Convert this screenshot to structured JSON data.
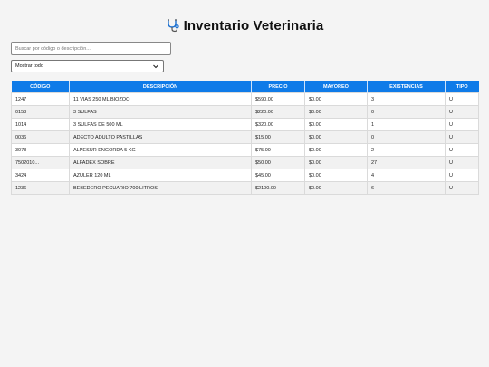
{
  "header": {
    "icon": "stethoscope-icon",
    "title": "Inventario Veterinaria"
  },
  "search": {
    "placeholder": "Buscar por código o descripción...",
    "value": ""
  },
  "filter": {
    "selected": "Mostrar todo"
  },
  "table": {
    "headers": [
      "CÓDIGO",
      "DESCRIPCIÓN",
      "PRECIO",
      "MAYOREO",
      "EXISTENCIAS",
      "TIPO"
    ],
    "rows": [
      [
        "1247",
        "11 VIAS 250 ML BIOZOO",
        "$590.00",
        "$0.00",
        "3",
        "U"
      ],
      [
        "0158",
        "3 SULFAS",
        "$220.00",
        "$0.00",
        "0",
        "U"
      ],
      [
        "1014",
        "3 SULFAS DE 500 ML",
        "$320.00",
        "$0.00",
        "1",
        "U"
      ],
      [
        "0036",
        "ADECTO ADULTO PASTILLAS",
        "$15.00",
        "$0.00",
        "0",
        "U"
      ],
      [
        "3078",
        "ALPESUR ENGORDA 5 KG",
        "$75.00",
        "$0.00",
        "2",
        "U"
      ],
      [
        "7502010...",
        "ALFADEX SOBRE",
        "$50.00",
        "$0.00",
        "27",
        "U"
      ],
      [
        "3424",
        "AZULER 120 ML",
        "$45.00",
        "$0.00",
        "4",
        "U"
      ],
      [
        "1236",
        "BEBEDERO PECUARIO 700 LITROS",
        "$2100.00",
        "$0.00",
        "6",
        "U"
      ]
    ]
  },
  "colors": {
    "header_bg": "#0f7be8",
    "header_text": "#ffffff",
    "icon_accent": "#1a6fd0"
  }
}
